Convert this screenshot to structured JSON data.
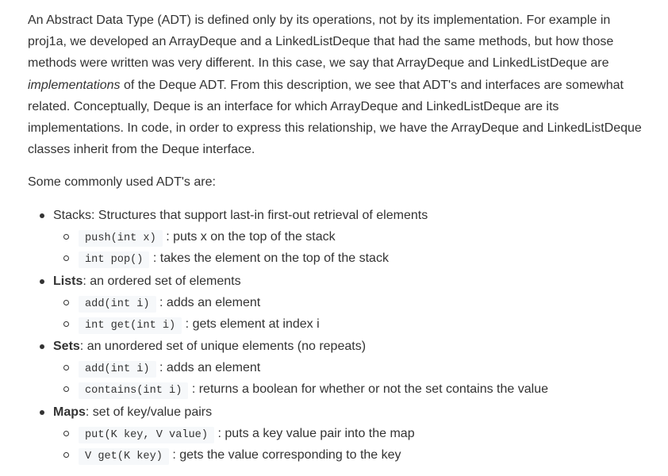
{
  "intro": {
    "part1": "An Abstract Data Type (ADT) is defined only by its operations, not by its implementation. For example in proj1a, we developed an ArrayDeque and a LinkedListDeque that had the same methods, but how those methods were written was very different. In this case, we say that ArrayDeque and LinkedListDeque are ",
    "emphasis": "implementations",
    "part2": " of the Deque ADT. From this description, we see that ADT's and interfaces are somewhat related. Conceptually, Deque is an interface for which ArrayDeque and LinkedListDeque are its implementations. In code, in order to express this relationship, we have the ArrayDeque and LinkedListDeque classes inherit from the Deque interface."
  },
  "lead": "Some commonly used ADT's are:",
  "adts": [
    {
      "name": "Stacks",
      "name_bold": false,
      "description": ": Structures that support last-in first-out retrieval of elements",
      "ops": [
        {
          "code": "push(int x)",
          "description": ": puts x on the top of the stack"
        },
        {
          "code": "int pop()",
          "description": ": takes the element on the top of the stack"
        }
      ]
    },
    {
      "name": "Lists",
      "name_bold": true,
      "description": ": an ordered set of elements",
      "ops": [
        {
          "code": "add(int i)",
          "description": ": adds an element"
        },
        {
          "code": "int get(int i)",
          "description": ": gets element at index i"
        }
      ]
    },
    {
      "name": "Sets",
      "name_bold": true,
      "description": ": an unordered set of unique elements (no repeats)",
      "ops": [
        {
          "code": "add(int i)",
          "description": ": adds an element"
        },
        {
          "code": "contains(int i)",
          "description": ": returns a boolean for whether or not the set contains the value"
        }
      ]
    },
    {
      "name": "Maps",
      "name_bold": true,
      "description": ": set of key/value pairs",
      "ops": [
        {
          "code": "put(K key, V value)",
          "description": ": puts a key value pair into the map"
        },
        {
          "code": "V get(K key)",
          "description": ": gets the value corresponding to the key"
        }
      ]
    }
  ]
}
